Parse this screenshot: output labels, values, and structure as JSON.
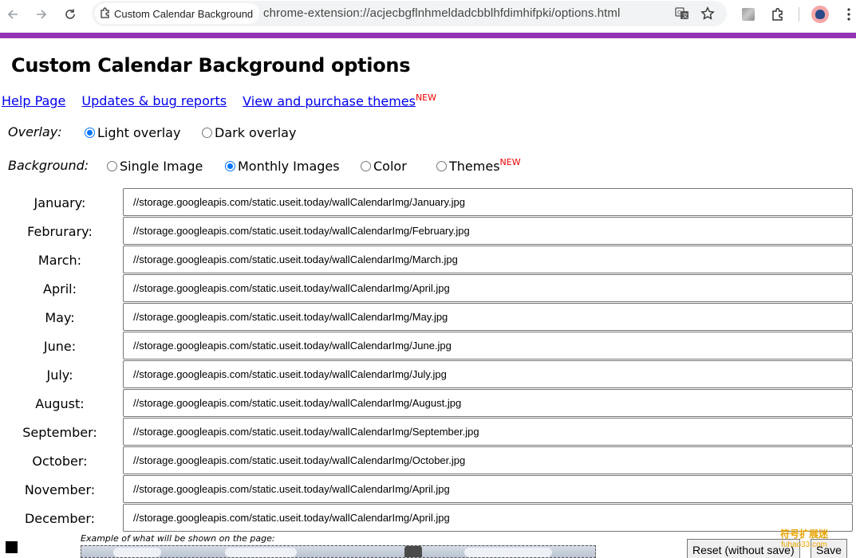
{
  "browser": {
    "tab_title": "Custom Calendar Background",
    "url": "chrome-extension://acjecbgflnhmeldadcbblhfdimhifpki/options.html"
  },
  "page": {
    "title": "Custom Calendar Background options",
    "links": {
      "help": "Help Page",
      "updates": "Updates & bug reports",
      "themes": "View and purchase themes",
      "new_tag": "NEW"
    },
    "overlay": {
      "label": "Overlay:",
      "options": [
        "Light overlay",
        "Dark overlay"
      ],
      "selected": "Light overlay"
    },
    "background": {
      "label": "Background:",
      "options": [
        "Single Image",
        "Monthly Images",
        "Color",
        "Themes"
      ],
      "selected": "Monthly Images",
      "themes_new_tag": "NEW"
    },
    "months": [
      {
        "label": "January:",
        "value": "//storage.googleapis.com/static.useit.today/wallCalendarImg/January.jpg"
      },
      {
        "label": "Februrary:",
        "value": "//storage.googleapis.com/static.useit.today/wallCalendarImg/February.jpg"
      },
      {
        "label": "March:",
        "value": "//storage.googleapis.com/static.useit.today/wallCalendarImg/March.jpg"
      },
      {
        "label": "April:",
        "value": "//storage.googleapis.com/static.useit.today/wallCalendarImg/April.jpg"
      },
      {
        "label": "May:",
        "value": "//storage.googleapis.com/static.useit.today/wallCalendarImg/May.jpg"
      },
      {
        "label": "June:",
        "value": "//storage.googleapis.com/static.useit.today/wallCalendarImg/June.jpg"
      },
      {
        "label": "July:",
        "value": "//storage.googleapis.com/static.useit.today/wallCalendarImg/July.jpg"
      },
      {
        "label": "August:",
        "value": "//storage.googleapis.com/static.useit.today/wallCalendarImg/August.jpg"
      },
      {
        "label": "September:",
        "value": "//storage.googleapis.com/static.useit.today/wallCalendarImg/September.jpg"
      },
      {
        "label": "October:",
        "value": "//storage.googleapis.com/static.useit.today/wallCalendarImg/October.jpg"
      },
      {
        "label": "November:",
        "value": "//storage.googleapis.com/static.useit.today/wallCalendarImg/April.jpg"
      },
      {
        "label": "December:",
        "value": "//storage.googleapis.com/static.useit.today/wallCalendarImg/April.jpg"
      }
    ],
    "example_caption": "Example of what will be shown on the page:",
    "buttons": {
      "reset": "Reset (without save)",
      "save": "Save"
    },
    "watermark": {
      "line1": "符号扩展迷",
      "line2": "fuhao33.com"
    }
  },
  "colors": {
    "accent_strip": "#9334b3",
    "link": "#0000ee",
    "new_tag": "#ee0000",
    "radio_checked": "#0075ff"
  },
  "icons": [
    "back-arrow-icon",
    "forward-arrow-icon",
    "reload-icon",
    "extension-puzzle-icon",
    "translate-icon",
    "star-icon",
    "extensions-icon",
    "profile-avatar",
    "more-menu-icon"
  ]
}
